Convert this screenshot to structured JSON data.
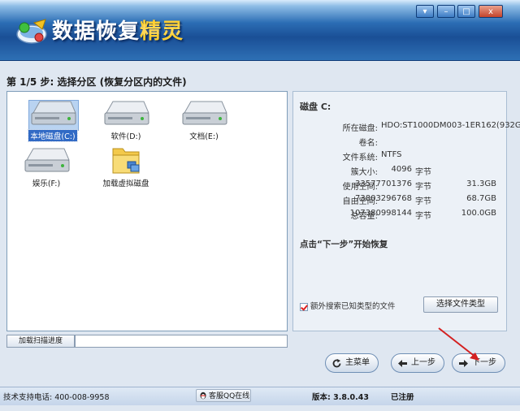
{
  "app": {
    "title_main": "数据恢复",
    "title_accent": "精灵",
    "window_controls": [
      "▾",
      "–",
      "□",
      "x"
    ]
  },
  "step": {
    "title": "第 1/5 步: 选择分区 (恢复分区内的文件)"
  },
  "partitions": [
    {
      "label": "本地磁盘(C:)",
      "icon": "hard-drive-icon",
      "selected": true
    },
    {
      "label": "软件(D:)",
      "icon": "hard-drive-icon",
      "selected": false
    },
    {
      "label": "文档(E:)",
      "icon": "hard-drive-icon",
      "selected": false
    },
    {
      "label": "娱乐(F:)",
      "icon": "hard-drive-icon",
      "selected": false
    },
    {
      "label": "加载虚拟磁盘",
      "icon": "folder-icon",
      "selected": false
    }
  ],
  "disk_info": {
    "title": "磁盘 C:",
    "rows": [
      {
        "key": "所在磁盘:",
        "value": "HDO:ST1000DM003-1ER162(932G"
      },
      {
        "key": "卷名:",
        "value": ""
      },
      {
        "key": "文件系统:",
        "value": "NTFS"
      },
      {
        "key": "簇大小:",
        "num": "4096",
        "unit": "字节",
        "size": ""
      },
      {
        "key": "使用空间:",
        "num": "33577701376",
        "unit": "字节",
        "size": "31.3GB"
      },
      {
        "key": "自由空间:",
        "num": "73803296768",
        "unit": "字节",
        "size": "68.7GB"
      },
      {
        "key": "总容量:",
        "num": "107380998144",
        "unit": "字节",
        "size": "100.0GB"
      }
    ],
    "hint": "点击“下一步”开始恢复",
    "extra_check_label": "额外搜索已知类型的文件",
    "extra_check_checked": true,
    "select_type_button": "选择文件类型"
  },
  "progress": {
    "load_button": "加载扫描进度",
    "fill": 0
  },
  "nav": {
    "menu": "主菜单",
    "prev": "上一步",
    "next": "下一步"
  },
  "status": {
    "phone": "技术支持电话: 400-008-9958",
    "qq": "客服QQ在线",
    "version": "版本: 3.8.0.43",
    "registered": "已注册"
  },
  "colors": {
    "title_accent": "#ffd033",
    "selection": "#316ac5",
    "arrow": "#d42020"
  }
}
